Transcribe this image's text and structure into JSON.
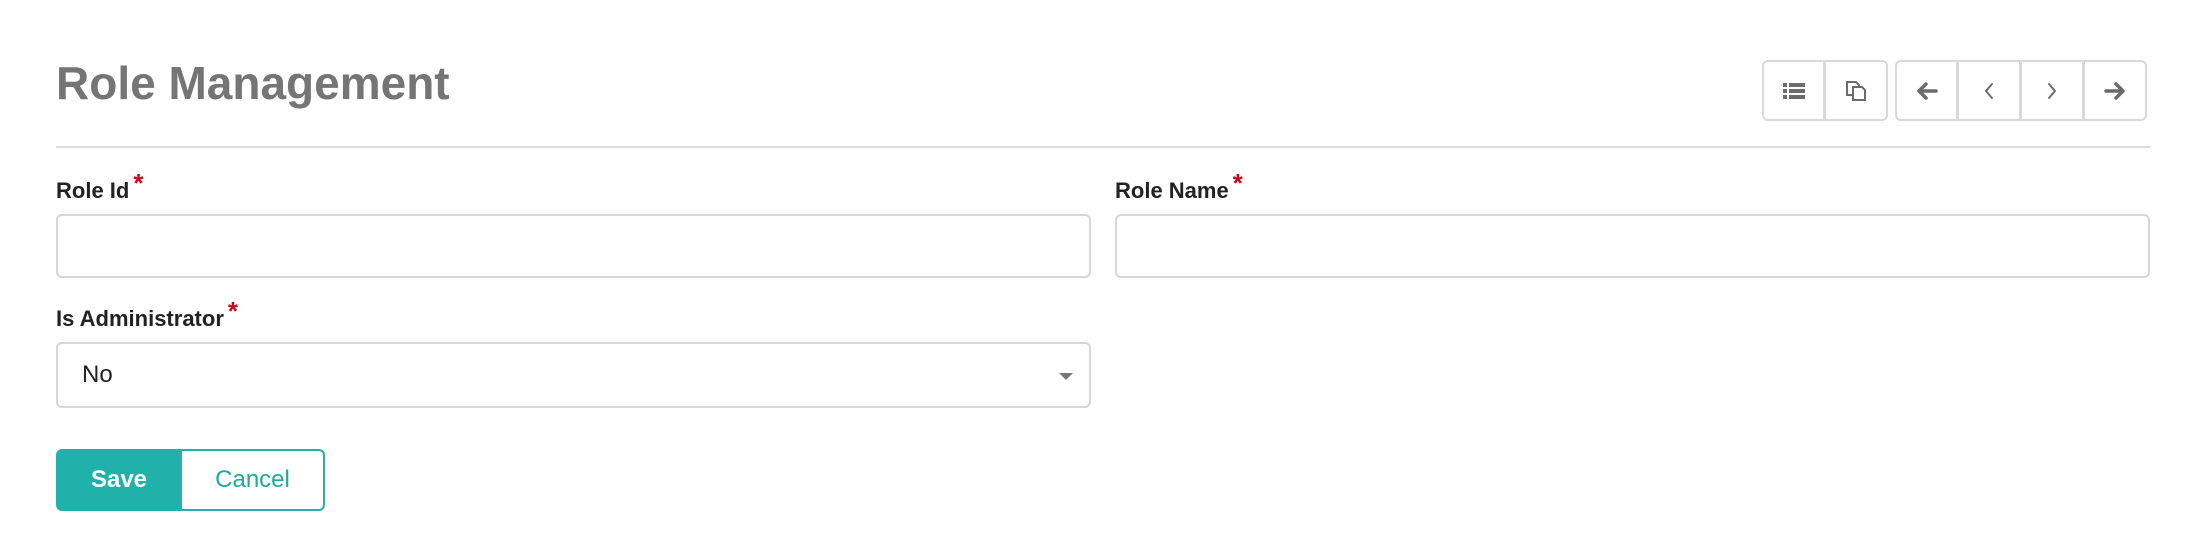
{
  "header": {
    "title": "Role Management"
  },
  "toolbar": {
    "buttons": [
      {
        "name": "list-view-button",
        "icon": "list-icon"
      },
      {
        "name": "copy-button",
        "icon": "copy-icon"
      },
      {
        "name": "first-record-button",
        "icon": "arrow-left-icon"
      },
      {
        "name": "previous-record-button",
        "icon": "chevron-left-icon"
      },
      {
        "name": "next-record-button",
        "icon": "chevron-right-icon"
      },
      {
        "name": "last-record-button",
        "icon": "arrow-right-icon"
      }
    ]
  },
  "form": {
    "role_id": {
      "label": "Role Id",
      "required_mark": "*",
      "value": ""
    },
    "role_name": {
      "label": "Role Name",
      "required_mark": "*",
      "value": ""
    },
    "is_administrator": {
      "label": "Is Administrator",
      "required_mark": "*",
      "selected": "No"
    }
  },
  "actions": {
    "save_label": "Save",
    "cancel_label": "Cancel"
  },
  "colors": {
    "accent": "#20b2aa",
    "required": "#d0021b",
    "title": "#757575"
  }
}
